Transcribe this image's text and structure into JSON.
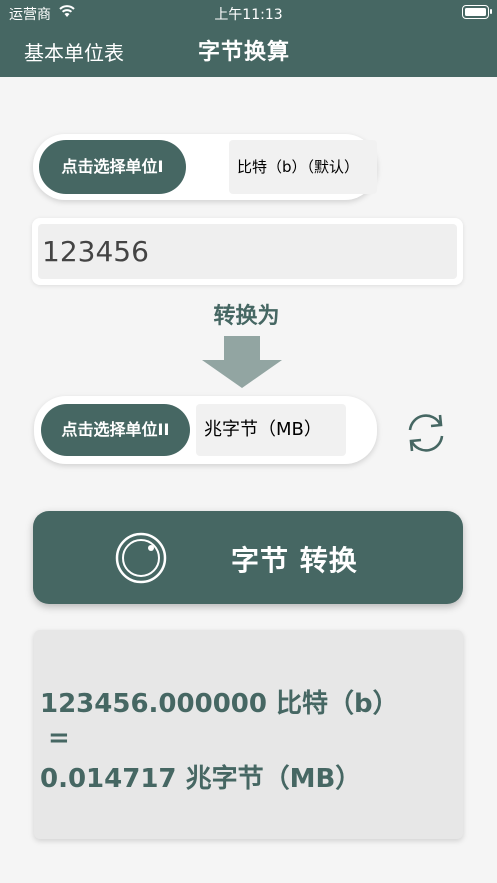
{
  "status": {
    "carrier": "运营商",
    "time": "上午11:13"
  },
  "nav": {
    "left_item": "基本单位表",
    "title": "字节换算"
  },
  "from_unit": {
    "choose_label": "点击选择单位I",
    "selected": "比特（b）（默认）"
  },
  "input": {
    "value": "123456"
  },
  "convert_to_label": "转换为",
  "to_unit": {
    "choose_label": "点击选择单位II",
    "selected": "兆字节（MB）"
  },
  "convert_button": {
    "label": "字节 转换"
  },
  "result": {
    "line1": "123456.000000 比特（b）",
    "line2": "=",
    "line3": "0.014717 兆字节（MB）"
  },
  "colors": {
    "primary": "#466763",
    "background": "#f5f5f5",
    "arrow": "#92a5a2"
  },
  "icons": {
    "wifi": "wifi-icon",
    "battery": "battery-icon",
    "arrow": "arrow-down-icon",
    "swap": "swap-refresh-icon",
    "button": "ring-icon"
  }
}
